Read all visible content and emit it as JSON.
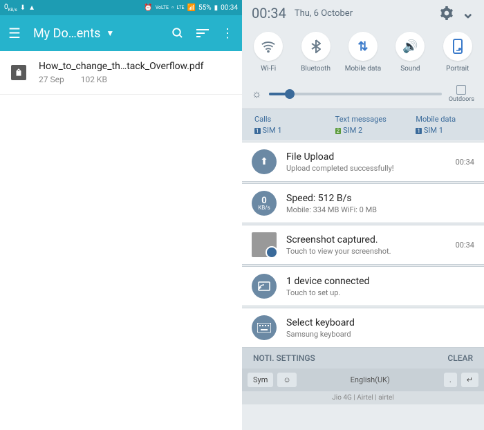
{
  "status": {
    "speed": "0",
    "speed_unit": "KB/s",
    "lte": "LTE",
    "battery": "55%",
    "time": "00:34"
  },
  "app": {
    "title": "My Do…ents"
  },
  "file": {
    "name": "How_to_change_th…tack_Overflow.pdf",
    "date": "27 Sep",
    "size": "102 KB"
  },
  "shade": {
    "time": "00:34",
    "date": "Thu, 6 October"
  },
  "toggles": {
    "wifi": "Wi-Fi",
    "bt": "Bluetooth",
    "data": "Mobile data",
    "sound": "Sound",
    "portrait": "Portrait"
  },
  "outdoors": "Outdoors",
  "sim": {
    "calls": {
      "title": "Calls",
      "sim": "SIM 1"
    },
    "texts": {
      "title": "Text messages",
      "sim": "SIM 2"
    },
    "data": {
      "title": "Mobile data",
      "sim": "SIM 1"
    }
  },
  "notifs": {
    "upload": {
      "title": "File Upload",
      "sub": "Upload completed successfully!",
      "time": "00:34"
    },
    "speed": {
      "num": "0",
      "unit": "KB/s",
      "title": "Speed: 512 B/s",
      "sub": "Mobile: 334 MB   WiFi: 0 MB"
    },
    "shot": {
      "title": "Screenshot captured.",
      "sub": "Touch to view your screenshot.",
      "time": "00:34"
    },
    "cast": {
      "title": "1 device connected",
      "sub": "Touch to set up."
    },
    "kbd": {
      "title": "Select keyboard",
      "sub": "Samsung keyboard"
    }
  },
  "footer": {
    "left": "NOTI. SETTINGS",
    "right": "CLEAR"
  },
  "keyboard": {
    "sym": "Sym",
    "lang": "English(UK)"
  },
  "carrier": "Jio 4G | Airtel | airtel"
}
